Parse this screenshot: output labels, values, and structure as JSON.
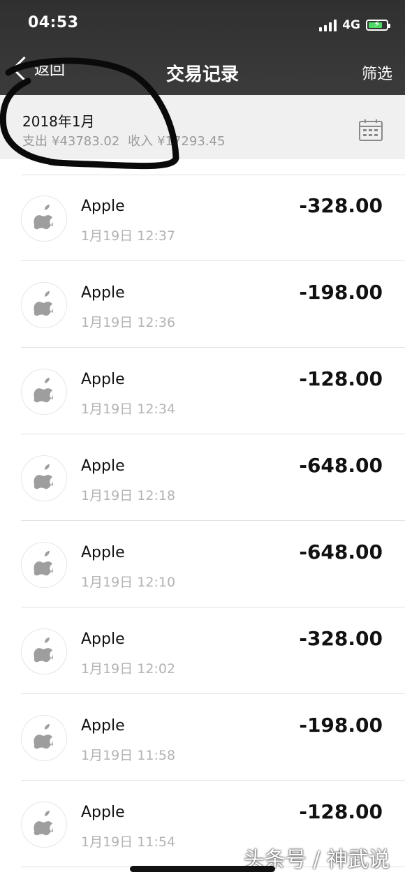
{
  "status_bar": {
    "time": "04:53",
    "network": "4G"
  },
  "nav": {
    "back_label": "返回",
    "title": "交易记录",
    "filter_label": "筛选"
  },
  "summary": {
    "month": "2018年1月",
    "expense_label": "支出",
    "expense_amount": "¥43783.02",
    "income_label": "收入",
    "income_amount": "¥17293.45"
  },
  "transactions": [
    {
      "merchant": "Apple",
      "time": "1月19日 12:37",
      "amount": "-328.00"
    },
    {
      "merchant": "Apple",
      "time": "1月19日 12:36",
      "amount": "-198.00"
    },
    {
      "merchant": "Apple",
      "time": "1月19日 12:34",
      "amount": "-128.00"
    },
    {
      "merchant": "Apple",
      "time": "1月19日 12:18",
      "amount": "-648.00"
    },
    {
      "merchant": "Apple",
      "time": "1月19日 12:10",
      "amount": "-648.00"
    },
    {
      "merchant": "Apple",
      "time": "1月19日 12:02",
      "amount": "-328.00"
    },
    {
      "merchant": "Apple",
      "time": "1月19日 11:58",
      "amount": "-198.00"
    },
    {
      "merchant": "Apple",
      "time": "1月19日 11:54",
      "amount": "-128.00"
    }
  ],
  "watermark": "头条号 / 神武说",
  "colors": {
    "header_bg": "#353535",
    "battery_green": "#4cd964",
    "secondary_text": "#b3b3b3"
  }
}
